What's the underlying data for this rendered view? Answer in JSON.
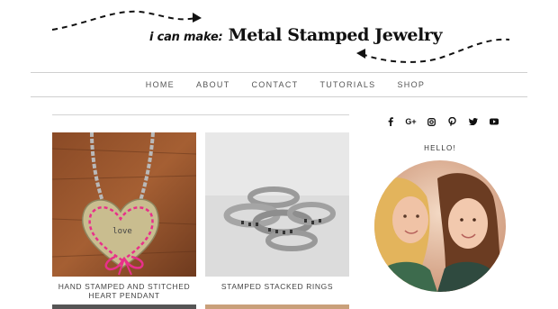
{
  "header": {
    "logo_prefix": "i can make:",
    "logo_main": "Metal Stamped Jewelry"
  },
  "nav": {
    "items": [
      "HOME",
      "ABOUT",
      "CONTACT",
      "TUTORIALS",
      "SHOP"
    ]
  },
  "posts": [
    {
      "title": "HAND STAMPED AND STITCHED HEART PENDANT",
      "stamp_text": "love"
    },
    {
      "title": "STAMPED STACKED RINGS"
    }
  ],
  "sidebar": {
    "social_icons": [
      "facebook-icon",
      "google-plus-icon",
      "instagram-icon",
      "pinterest-icon",
      "twitter-icon",
      "youtube-icon"
    ],
    "hello_title": "HELLO!"
  },
  "colors": {
    "text_dark": "#111111",
    "nav_text": "#555555",
    "rule": "#cfcfcf",
    "pink_thread": "#e8308a"
  }
}
